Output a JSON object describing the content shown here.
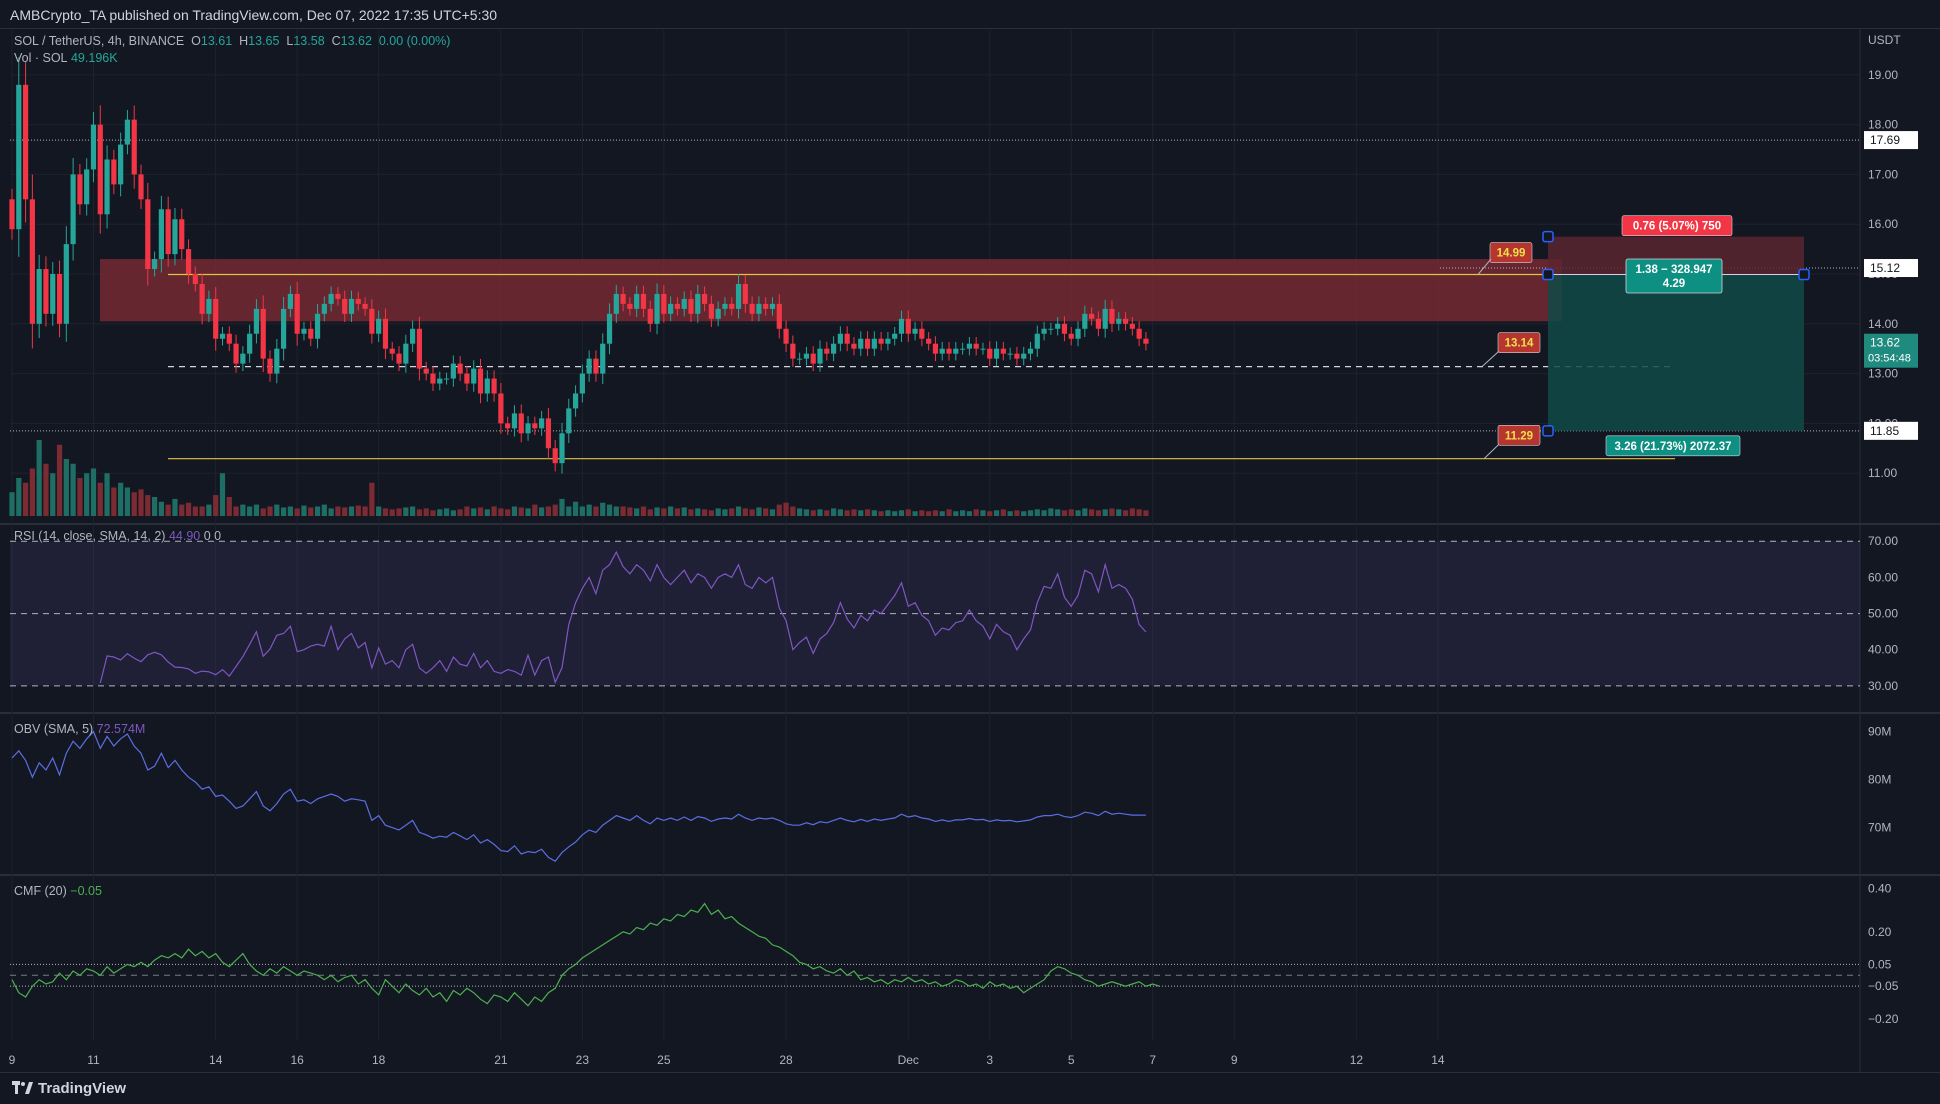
{
  "header": {
    "published": "AMBCrypto_TA published on TradingView.com, Dec 07, 2022 17:35 UTC+5:30"
  },
  "footer": {
    "brand": "TradingView"
  },
  "legend": {
    "symbol": "SOL / TetherUS, 4h, BINANCE",
    "o_label": "O",
    "o": "13.61",
    "h_label": "H",
    "h": "13.65",
    "l_label": "L",
    "l": "13.58",
    "c_label": "C",
    "c": "13.62",
    "chg": "0.00 (0.00%)",
    "vol_label": "Vol · SOL",
    "vol": "49.196K",
    "rsi_label": "RSI (14, close, SMA, 14, 2)",
    "rsi": "44.90",
    "rsi_extra": "0  0",
    "obv_label": "OBV (SMA, 5)",
    "obv": "72.574M",
    "cmf_label": "CMF (20)",
    "cmf": "−0.05"
  },
  "colors": {
    "up": "#26a69a",
    "down": "#f23645",
    "bg": "#131722",
    "grid": "#1e222d",
    "zone": "#7a2a33",
    "rsi_line": "#7e57c2",
    "obv_line": "#5b6ee1",
    "cmf_line": "#4caf50",
    "level_yellow": "#e0c341",
    "target_fill": "#0f4a45",
    "stop_fill": "#5a2630"
  },
  "price_axis": {
    "unit": "USDT",
    "ticks": [
      "19.00",
      "18.00",
      "17.00",
      "16.00",
      "15.00",
      "14.00",
      "13.00",
      "12.00",
      "11.00"
    ],
    "ymin": 10.3,
    "ymax": 19.7,
    "tags": [
      {
        "text": "17.69",
        "value": 17.69,
        "style": "white"
      },
      {
        "text": "15.12",
        "value": 15.12,
        "style": "white"
      },
      {
        "text": "13.62",
        "value": 13.62,
        "style": "green"
      },
      {
        "text": "03:54:48",
        "value": 13.62,
        "style": "green-sub"
      },
      {
        "text": "11.85",
        "value": 11.85,
        "style": "white"
      }
    ]
  },
  "rsi_axis": {
    "ticks": [
      "70.00",
      "60.00",
      "50.00",
      "40.00",
      "30.00"
    ],
    "ymin": 25,
    "ymax": 72
  },
  "obv_axis": {
    "ticks": [
      "90M",
      "80M",
      "70M"
    ],
    "ymin": 62,
    "ymax": 92
  },
  "cmf_axis": {
    "ticks": [
      "0.40",
      "0.20",
      "0.05",
      "−0.05",
      "−0.20"
    ],
    "ymin": -0.27,
    "ymax": 0.42
  },
  "time_axis": {
    "ticks": [
      {
        "text": "9",
        "i": 0
      },
      {
        "text": "11",
        "i": 12
      },
      {
        "text": "14",
        "i": 30
      },
      {
        "text": "16",
        "i": 42
      },
      {
        "text": "18",
        "i": 54
      },
      {
        "text": "21",
        "i": 72
      },
      {
        "text": "23",
        "i": 84
      },
      {
        "text": "25",
        "i": 96
      },
      {
        "text": "28",
        "i": 114
      },
      {
        "text": "Dec",
        "i": 132
      },
      {
        "text": "3",
        "i": 144
      },
      {
        "text": "5",
        "i": 156
      },
      {
        "text": "7",
        "i": 168
      },
      {
        "text": "9",
        "i": 180
      },
      {
        "text": "12",
        "i": 198
      },
      {
        "text": "14",
        "i": 210
      }
    ]
  },
  "annotations": {
    "res_tag": "14.99",
    "sup_tag": "13.14",
    "low_tag": "11.29",
    "stop_box": "0.76 (5.07%) 750",
    "entry_box": "1.38 − 328.947",
    "entry_sub": "4.29",
    "target_box": "3.26 (21.73%) 2072.37"
  },
  "chart_data": {
    "type": "candlestick",
    "symbol": "SOL / TetherUS",
    "interval": "4h",
    "exchange": "BINANCE",
    "x_labels": [
      "9",
      "11",
      "14",
      "16",
      "18",
      "21",
      "23",
      "25",
      "28",
      "Dec",
      "3",
      "5",
      "7",
      "9",
      "12",
      "14"
    ],
    "levels": {
      "resistance_zone": [
        14.05,
        15.3
      ],
      "resistance_line": 14.99,
      "support_line": 13.14,
      "low_line": 11.29,
      "hline_17_69": 17.69,
      "hline_11_85": 11.85
    },
    "position": {
      "entry": 14.99,
      "stop": 15.75,
      "target": 11.85
    },
    "close": [
      15.9,
      18.8,
      16.5,
      14.0,
      15.1,
      14.2,
      15.0,
      14.0,
      15.6,
      17.0,
      16.4,
      17.1,
      18.0,
      16.2,
      17.3,
      16.8,
      17.6,
      18.1,
      17.0,
      16.5,
      15.1,
      15.3,
      16.3,
      15.4,
      16.1,
      15.5,
      15.0,
      14.8,
      14.2,
      14.5,
      13.7,
      13.8,
      13.6,
      13.2,
      13.4,
      13.8,
      14.3,
      13.3,
      13.0,
      13.5,
      14.3,
      14.6,
      13.8,
      13.9,
      13.7,
      14.2,
      14.4,
      14.6,
      14.5,
      14.2,
      14.5,
      14.4,
      14.3,
      13.8,
      14.1,
      13.5,
      13.4,
      13.2,
      13.6,
      13.9,
      13.1,
      13.0,
      12.8,
      12.9,
      12.9,
      13.2,
      13.0,
      12.8,
      13.1,
      12.6,
      12.9,
      12.6,
      12.0,
      11.9,
      12.2,
      11.8,
      12.0,
      11.9,
      12.1,
      11.5,
      11.2,
      11.8,
      12.3,
      12.6,
      13.0,
      13.3,
      13.0,
      13.6,
      14.2,
      14.6,
      14.4,
      14.3,
      14.6,
      14.3,
      14.0,
      14.6,
      14.2,
      14.4,
      14.3,
      14.5,
      14.2,
      14.6,
      14.4,
      14.1,
      14.3,
      14.4,
      14.3,
      14.8,
      14.4,
      14.2,
      14.4,
      14.3,
      14.4,
      13.9,
      13.6,
      13.3,
      13.3,
      13.4,
      13.2,
      13.5,
      13.4,
      13.6,
      13.8,
      13.6,
      13.5,
      13.7,
      13.5,
      13.7,
      13.6,
      13.7,
      13.8,
      14.1,
      13.8,
      13.9,
      13.7,
      13.6,
      13.4,
      13.5,
      13.4,
      13.5,
      13.5,
      13.6,
      13.5,
      13.5,
      13.3,
      13.5,
      13.4,
      13.4,
      13.3,
      13.4,
      13.5,
      13.8,
      13.9,
      13.9,
      14.0,
      13.8,
      13.7,
      13.9,
      14.2,
      14.1,
      13.9,
      14.3,
      14.0,
      14.1,
      14.0,
      13.9,
      13.7,
      13.6
    ],
    "volume": [
      0.25,
      0.4,
      0.35,
      0.5,
      0.8,
      0.55,
      0.45,
      0.75,
      0.6,
      0.55,
      0.4,
      0.45,
      0.5,
      0.35,
      0.45,
      0.3,
      0.35,
      0.3,
      0.25,
      0.28,
      0.22,
      0.2,
      0.15,
      0.12,
      0.18,
      0.12,
      0.14,
      0.1,
      0.1,
      0.12,
      0.22,
      0.45,
      0.2,
      0.1,
      0.12,
      0.1,
      0.12,
      0.08,
      0.1,
      0.12,
      0.09,
      0.1,
      0.08,
      0.11,
      0.09,
      0.1,
      0.12,
      0.08,
      0.1,
      0.09,
      0.1,
      0.11,
      0.1,
      0.35,
      0.1,
      0.08,
      0.07,
      0.08,
      0.09,
      0.1,
      0.07,
      0.08,
      0.06,
      0.07,
      0.08,
      0.06,
      0.07,
      0.1,
      0.08,
      0.09,
      0.07,
      0.1,
      0.08,
      0.07,
      0.1,
      0.09,
      0.08,
      0.12,
      0.09,
      0.1,
      0.12,
      0.18,
      0.1,
      0.15,
      0.1,
      0.12,
      0.1,
      0.14,
      0.12,
      0.1,
      0.1,
      0.09,
      0.08,
      0.1,
      0.07,
      0.09,
      0.08,
      0.1,
      0.08,
      0.09,
      0.07,
      0.08,
      0.07,
      0.06,
      0.08,
      0.07,
      0.08,
      0.1,
      0.08,
      0.07,
      0.09,
      0.08,
      0.07,
      0.12,
      0.14,
      0.1,
      0.08,
      0.07,
      0.06,
      0.07,
      0.06,
      0.08,
      0.07,
      0.06,
      0.07,
      0.06,
      0.07,
      0.06,
      0.05,
      0.06,
      0.05,
      0.06,
      0.07,
      0.05,
      0.06,
      0.05,
      0.06,
      0.05,
      0.07,
      0.05,
      0.06,
      0.05,
      0.07,
      0.06,
      0.05,
      0.06,
      0.07,
      0.05,
      0.06,
      0.05,
      0.06,
      0.07,
      0.06,
      0.08,
      0.07,
      0.06,
      0.07,
      0.06,
      0.08,
      0.07,
      0.06,
      0.07,
      0.08,
      0.07,
      0.06,
      0.08,
      0.07,
      0.06
    ],
    "rsi": [
      null,
      null,
      null,
      null,
      null,
      null,
      null,
      null,
      null,
      null,
      null,
      null,
      null,
      30.8,
      38.3,
      38.0,
      37.2,
      38.9,
      37.7,
      36.7,
      38.6,
      39.3,
      38.6,
      36.6,
      35.2,
      35.1,
      34.7,
      33.5,
      34.1,
      33.9,
      33.1,
      34.5,
      32.7,
      35.4,
      38.1,
      41.5,
      45.0,
      38.2,
      40.2,
      44.0,
      44.5,
      46.5,
      39.5,
      40.0,
      41.0,
      41.5,
      41.0,
      46.5,
      40.0,
      43.0,
      44.5,
      40.5,
      42.0,
      35.0,
      40.5,
      36.0,
      37.0,
      35.0,
      40.0,
      41.5,
      35.0,
      33.5,
      35.0,
      37.0,
      34.0,
      38.0,
      36.0,
      35.5,
      39.0,
      35.0,
      37.0,
      34.0,
      33.5,
      34.5,
      34.0,
      33.0,
      38.5,
      33.0,
      37.0,
      38.0,
      31.0,
      35.0,
      47.0,
      53.0,
      57.0,
      60.0,
      55.5,
      62.0,
      63.5,
      67.0,
      63.0,
      61.0,
      63.5,
      62.0,
      59.0,
      63.5,
      60.0,
      58.0,
      60.0,
      62.0,
      58.5,
      61.0,
      60.0,
      57.0,
      60.0,
      61.0,
      60.0,
      63.5,
      58.0,
      57.0,
      60.0,
      58.5,
      60.0,
      51.5,
      48.0,
      40.0,
      42.0,
      43.5,
      39.0,
      43.0,
      44.5,
      47.5,
      53.0,
      48.5,
      46.0,
      49.5,
      48.0,
      51.0,
      50.0,
      52.5,
      55.0,
      58.5,
      52.0,
      53.0,
      49.5,
      48.0,
      44.0,
      46.0,
      45.5,
      47.5,
      48.0,
      51.0,
      48.0,
      46.5,
      43.0,
      47.0,
      45.0,
      44.0,
      40.0,
      43.0,
      45.5,
      53.0,
      57.5,
      57.0,
      61.0,
      54.5,
      52.0,
      55.0,
      62.0,
      61.0,
      56.0,
      63.5,
      57.0,
      58.0,
      57.0,
      54.0,
      47.0,
      44.9
    ],
    "obv": [
      84.5,
      86.0,
      84.0,
      80.5,
      83.5,
      82.0,
      84.5,
      81.0,
      85.5,
      88.0,
      86.5,
      88.5,
      90.0,
      86.5,
      89.0,
      87.0,
      88.5,
      89.5,
      87.0,
      85.5,
      82.0,
      82.8,
      85.5,
      82.5,
      84.0,
      82.0,
      80.5,
      79.5,
      78.0,
      78.5,
      76.5,
      76.8,
      75.5,
      74.0,
      74.5,
      76.0,
      77.5,
      74.5,
      73.5,
      75.0,
      77.0,
      78.0,
      75.5,
      75.8,
      75.0,
      76.0,
      76.5,
      77.0,
      76.5,
      75.5,
      76.0,
      75.8,
      75.5,
      71.5,
      72.5,
      70.5,
      70.0,
      69.5,
      70.5,
      71.5,
      69.0,
      68.5,
      67.8,
      68.2,
      68.0,
      69.0,
      68.3,
      67.5,
      68.5,
      66.8,
      67.5,
      66.5,
      65.2,
      65.0,
      66.2,
      64.5,
      65.0,
      64.8,
      65.5,
      63.8,
      63.0,
      64.8,
      66.0,
      67.0,
      68.5,
      69.5,
      69.0,
      70.5,
      71.5,
      72.5,
      72.0,
      71.5,
      72.5,
      71.5,
      70.8,
      72.0,
      71.5,
      72.0,
      71.5,
      72.2,
      71.5,
      72.3,
      72.0,
      71.3,
      71.8,
      72.0,
      71.8,
      72.8,
      72.0,
      71.5,
      72.0,
      71.8,
      72.0,
      71.5,
      70.8,
      70.5,
      70.5,
      71.0,
      70.6,
      71.2,
      71.0,
      71.5,
      72.0,
      71.5,
      71.2,
      71.7,
      71.3,
      71.8,
      71.5,
      71.8,
      72.0,
      72.8,
      72.2,
      72.5,
      72.0,
      71.8,
      71.3,
      71.6,
      71.3,
      71.6,
      71.6,
      71.9,
      71.6,
      71.7,
      71.3,
      71.6,
      71.4,
      71.5,
      71.2,
      71.4,
      71.6,
      72.2,
      72.5,
      72.5,
      72.8,
      72.3,
      72.1,
      72.5,
      73.2,
      73.0,
      72.5,
      73.4,
      72.8,
      73.0,
      72.8,
      72.6,
      72.6,
      72.574
    ],
    "cmf": [
      -0.02,
      -0.08,
      -0.1,
      -0.05,
      -0.02,
      -0.04,
      -0.03,
      0.01,
      -0.02,
      0.02,
      0.0,
      0.03,
      0.02,
      0.0,
      0.04,
      0.01,
      0.03,
      0.05,
      0.04,
      0.06,
      0.04,
      0.07,
      0.09,
      0.08,
      0.1,
      0.08,
      0.12,
      0.09,
      0.11,
      0.08,
      0.1,
      0.06,
      0.04,
      0.07,
      0.1,
      0.05,
      0.02,
      0.0,
      0.03,
      0.01,
      0.04,
      0.02,
      0.0,
      0.02,
      0.01,
      0.0,
      -0.02,
      0.0,
      -0.03,
      -0.01,
      0.0,
      -0.04,
      -0.02,
      -0.06,
      -0.09,
      -0.02,
      -0.05,
      -0.08,
      -0.04,
      -0.07,
      -0.09,
      -0.06,
      -0.1,
      -0.08,
      -0.12,
      -0.07,
      -0.09,
      -0.06,
      -0.08,
      -0.11,
      -0.13,
      -0.09,
      -0.1,
      -0.12,
      -0.08,
      -0.11,
      -0.14,
      -0.1,
      -0.12,
      -0.08,
      -0.06,
      0.0,
      0.03,
      0.05,
      0.08,
      0.1,
      0.12,
      0.14,
      0.16,
      0.18,
      0.2,
      0.19,
      0.22,
      0.21,
      0.24,
      0.23,
      0.26,
      0.25,
      0.28,
      0.27,
      0.3,
      0.29,
      0.33,
      0.28,
      0.3,
      0.26,
      0.27,
      0.24,
      0.22,
      0.2,
      0.18,
      0.17,
      0.14,
      0.13,
      0.11,
      0.09,
      0.06,
      0.05,
      0.03,
      0.04,
      0.02,
      0.01,
      0.03,
      0.0,
      0.02,
      -0.02,
      -0.01,
      -0.03,
      -0.02,
      -0.04,
      -0.02,
      -0.03,
      -0.01,
      -0.03,
      -0.02,
      -0.04,
      -0.03,
      -0.05,
      -0.04,
      -0.02,
      -0.03,
      -0.05,
      -0.04,
      -0.06,
      -0.03,
      -0.05,
      -0.04,
      -0.06,
      -0.05,
      -0.08,
      -0.06,
      -0.04,
      -0.02,
      0.02,
      0.04,
      0.03,
      0.01,
      0.0,
      -0.02,
      -0.03,
      -0.05,
      -0.04,
      -0.03,
      -0.04,
      -0.05,
      -0.04,
      -0.03,
      -0.05,
      -0.04,
      -0.05
    ]
  }
}
